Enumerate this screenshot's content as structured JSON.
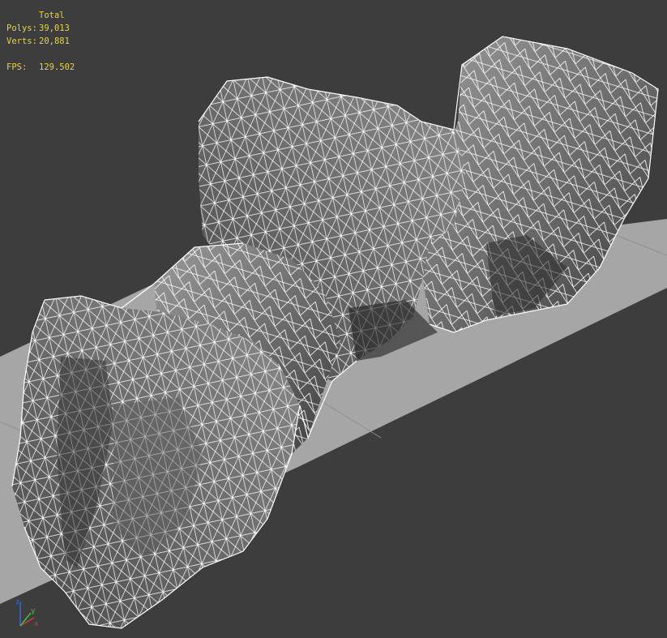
{
  "viewport": {
    "name": "Perspective viewport",
    "mode": "wireframe-on-shaded"
  },
  "stats": {
    "header": "Total",
    "polys_label": "Polys:",
    "polys_value": "39,013",
    "verts_label": "Verts:",
    "verts_value": "20,881",
    "fps_label": "FPS:",
    "fps_value": "129.502"
  },
  "axis_gizmo": {
    "x_label": "x",
    "y_label": "y",
    "z_label": "z",
    "x_color": "#d43a3a",
    "y_color": "#3ac43a",
    "z_color": "#3a6ad4"
  },
  "colors": {
    "background": "#3d3d3d",
    "ground_plane": "#a8a8a8",
    "wireframe": "#ffffff",
    "stats_text": "#e8d24a"
  },
  "icons": {
    "axis_gizmo": "xyz-axis-tripod-icon"
  }
}
